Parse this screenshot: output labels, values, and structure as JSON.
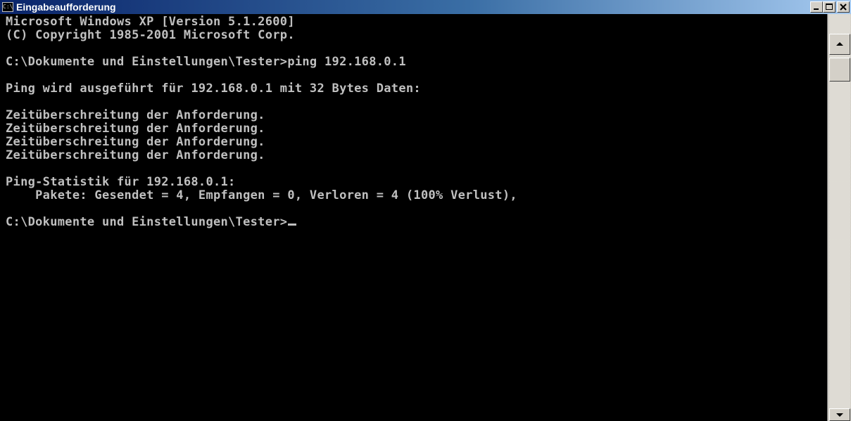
{
  "window": {
    "title": "Eingabeaufforderung",
    "icon": "cmd-icon",
    "icon_text": "C:\\"
  },
  "caption_buttons": {
    "minimize": "minimize-icon",
    "maximize": "maximize-icon",
    "close": "close-icon"
  },
  "console": {
    "lines": [
      "Microsoft Windows XP [Version 5.1.2600]",
      "(C) Copyright 1985-2001 Microsoft Corp.",
      "",
      "C:\\Dokumente und Einstellungen\\Tester>ping 192.168.0.1",
      "",
      "Ping wird ausgeführt für 192.168.0.1 mit 32 Bytes Daten:",
      "",
      "Zeitüberschreitung der Anforderung.",
      "Zeitüberschreitung der Anforderung.",
      "Zeitüberschreitung der Anforderung.",
      "Zeitüberschreitung der Anforderung.",
      "",
      "Ping-Statistik für 192.168.0.1:",
      "    Pakete: Gesendet = 4, Empfangen = 0, Verloren = 4 (100% Verlust),",
      "",
      "C:\\Dokumente und Einstellungen\\Tester>"
    ],
    "colors": {
      "background": "#000000",
      "foreground": "#c0c0c0"
    }
  },
  "scrollbar": {
    "up": "scroll-up-arrow-icon",
    "down": "scroll-down-arrow-icon"
  }
}
